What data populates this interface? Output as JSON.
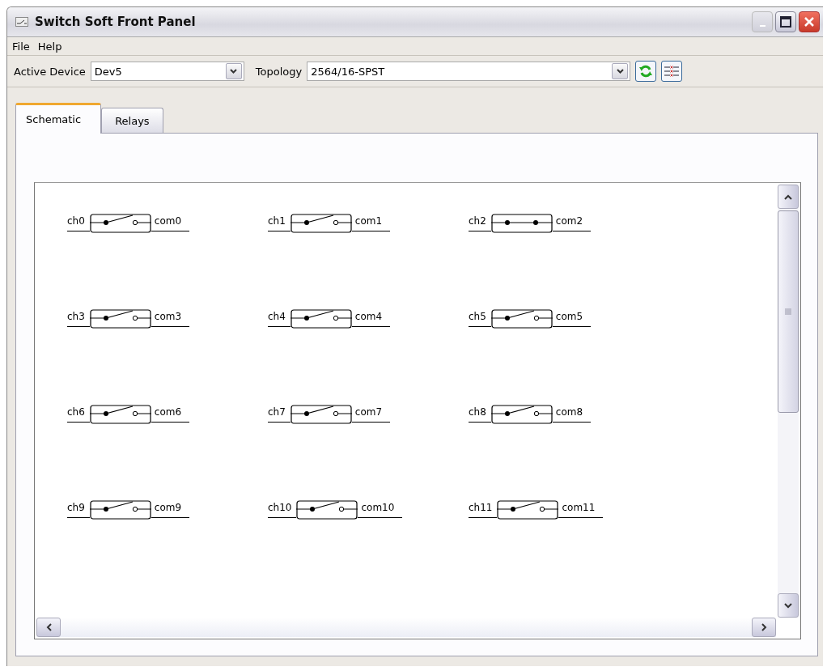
{
  "window": {
    "title": "Switch Soft Front Panel"
  },
  "menu": [
    "File",
    "Help"
  ],
  "toolbar": {
    "device_label": "Active Device",
    "device_value": "Dev5",
    "topology_label": "Topology",
    "topology_value": "2564/16-SPST"
  },
  "tabs": [
    {
      "label": "Schematic",
      "selected": true
    },
    {
      "label": "Relays",
      "selected": false
    }
  ],
  "switches": [
    {
      "channel": "ch0",
      "common": "com0",
      "closed": false
    },
    {
      "channel": "ch1",
      "common": "com1",
      "closed": false
    },
    {
      "channel": "ch2",
      "common": "com2",
      "closed": true
    },
    {
      "channel": "ch3",
      "common": "com3",
      "closed": false
    },
    {
      "channel": "ch4",
      "common": "com4",
      "closed": false
    },
    {
      "channel": "ch5",
      "common": "com5",
      "closed": false
    },
    {
      "channel": "ch6",
      "common": "com6",
      "closed": false
    },
    {
      "channel": "ch7",
      "common": "com7",
      "closed": false
    },
    {
      "channel": "ch8",
      "common": "com8",
      "closed": false
    },
    {
      "channel": "ch9",
      "common": "com9",
      "closed": false
    },
    {
      "channel": "ch10",
      "common": "com10",
      "closed": false
    },
    {
      "channel": "ch11",
      "common": "com11",
      "closed": false
    }
  ]
}
